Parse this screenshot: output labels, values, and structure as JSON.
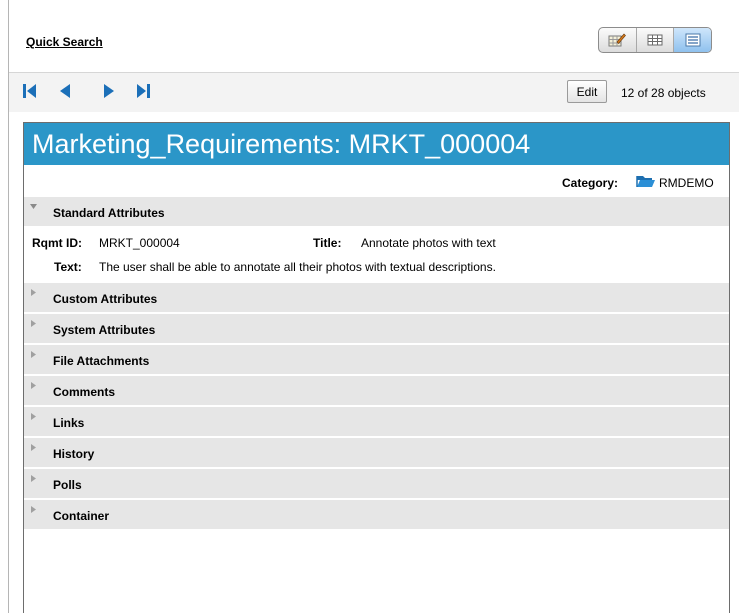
{
  "header": {
    "quick_search": "Quick Search",
    "view_modes": [
      {
        "icon": "edit-form-icon",
        "active": false
      },
      {
        "icon": "grid-view-icon",
        "active": false
      },
      {
        "icon": "list-view-icon",
        "active": true
      }
    ]
  },
  "nav": {
    "first_icon": "first-record-icon",
    "prev_icon": "previous-record-icon",
    "next_icon": "next-record-icon",
    "last_icon": "last-record-icon",
    "edit_label": "Edit",
    "count": "12 of 28 objects"
  },
  "record": {
    "title": "Marketing_Requirements: MRKT_000004",
    "category_label": "Category:",
    "category_value": "RMDEMO",
    "standard": {
      "label": "Standard Attributes",
      "rqmt_id_label": "Rqmt ID:",
      "rqmt_id_value": "MRKT_000004",
      "title_label": "Title:",
      "title_value": "Annotate photos with text",
      "text_label": "Text:",
      "text_value": "The user shall be able to annotate all their photos with textual descriptions."
    },
    "sections": [
      "Custom Attributes",
      "System Attributes",
      "File Attachments",
      "Comments",
      "Links",
      "History",
      "Polls",
      "Container"
    ]
  },
  "colors": {
    "title_bar": "#2b96c8",
    "section_bg": "#e6e6e6",
    "nav_arrow": "#1b6fb8"
  }
}
